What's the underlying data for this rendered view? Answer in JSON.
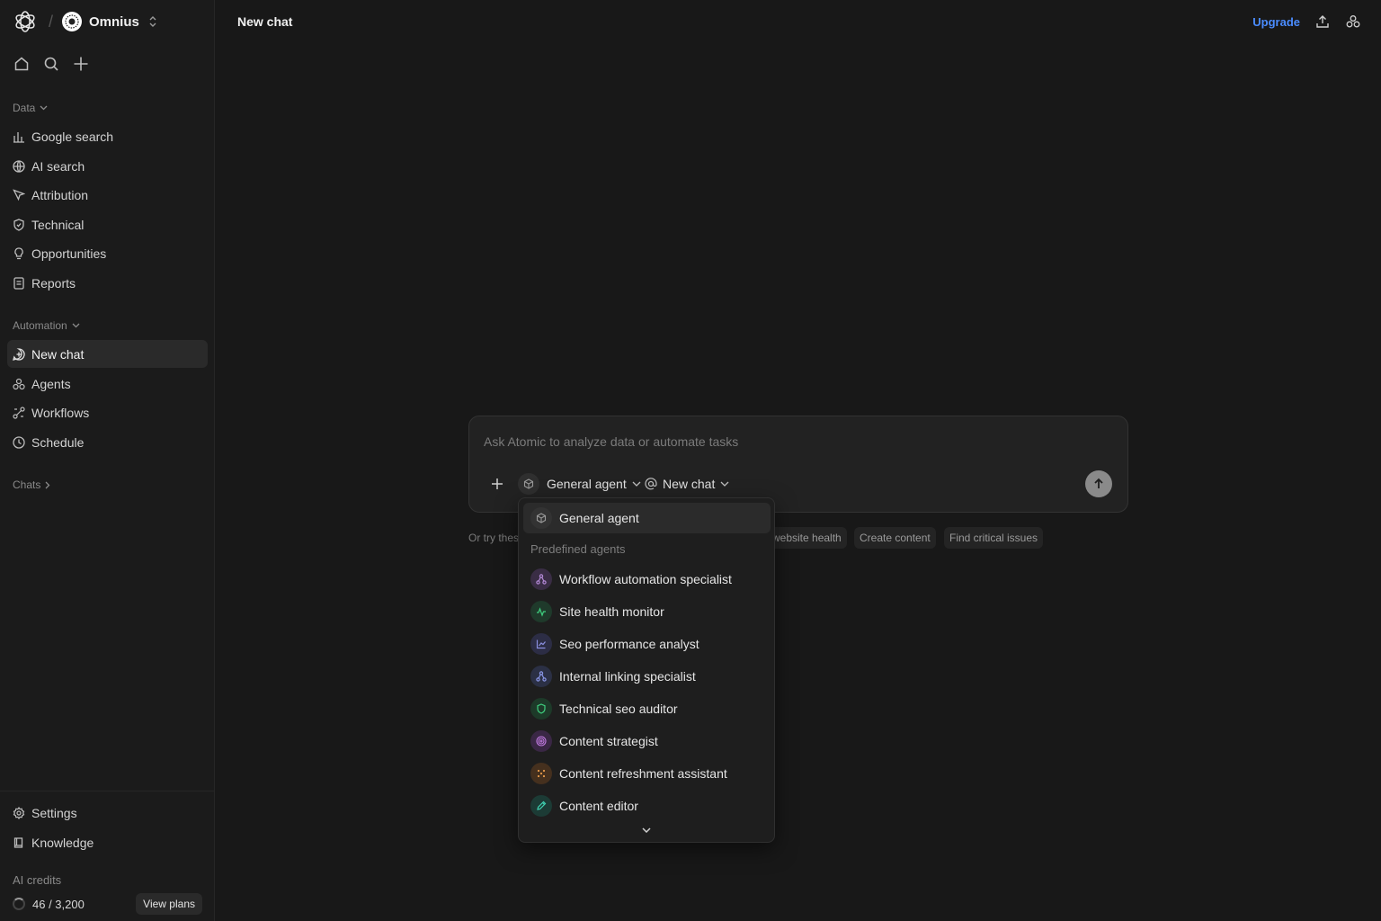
{
  "app": {
    "workspace_name": "Omnius"
  },
  "sidebar": {
    "data_section_label": "Data",
    "data_items": [
      {
        "label": "Google search",
        "icon": "bar-chart-icon"
      },
      {
        "label": "AI search",
        "icon": "globe-icon"
      },
      {
        "label": "Attribution",
        "icon": "cursor-icon"
      },
      {
        "label": "Technical",
        "icon": "shield-icon"
      },
      {
        "label": "Opportunities",
        "icon": "lightbulb-icon"
      },
      {
        "label": "Reports",
        "icon": "report-icon"
      }
    ],
    "automation_section_label": "Automation",
    "automation_items": [
      {
        "label": "New chat",
        "icon": "chat-plus-icon",
        "active": true
      },
      {
        "label": "Agents",
        "icon": "agents-icon"
      },
      {
        "label": "Workflows",
        "icon": "workflow-icon"
      },
      {
        "label": "Schedule",
        "icon": "clock-icon"
      }
    ],
    "chats_section_label": "Chats",
    "bottom_items": [
      {
        "label": "Settings",
        "icon": "gear-icon"
      },
      {
        "label": "Knowledge",
        "icon": "book-icon"
      }
    ],
    "credits_label": "AI credits",
    "credits_value": "46 / 3,200",
    "credits_used": 46,
    "credits_total": 3200,
    "view_plans_label": "View plans"
  },
  "header": {
    "title": "New chat",
    "upgrade_label": "Upgrade"
  },
  "composer": {
    "placeholder": "Ask Atomic to analyze data or automate tasks",
    "agent_label": "General agent",
    "chat_label": "New chat"
  },
  "suggestions": {
    "prefix": "Or try thes",
    "chips": [
      "website health",
      "Create content",
      "Find critical issues"
    ]
  },
  "agent_dropdown": {
    "selected": "General agent",
    "group_label": "Predefined agents",
    "agents": [
      {
        "label": "Workflow automation specialist",
        "icon": "workflow-icon",
        "color": "#b58ad8",
        "bg": "#3a2d45"
      },
      {
        "label": "Site health monitor",
        "icon": "pulse-icon",
        "color": "#3fcf7f",
        "bg": "#1f3a2b"
      },
      {
        "label": "Seo performance analyst",
        "icon": "line-chart-icon",
        "color": "#8a8fe0",
        "bg": "#2c2d45"
      },
      {
        "label": "Internal linking specialist",
        "icon": "network-icon",
        "color": "#8a97e8",
        "bg": "#2b3045"
      },
      {
        "label": "Technical seo auditor",
        "icon": "shield-icon",
        "color": "#3fcf7f",
        "bg": "#1d3a29"
      },
      {
        "label": "Content strategist",
        "icon": "target-icon",
        "color": "#c07ae0",
        "bg": "#3a2745"
      },
      {
        "label": "Content refreshment assistant",
        "icon": "sparkle-icon",
        "color": "#e89a4a",
        "bg": "#45301e"
      },
      {
        "label": "Content editor",
        "icon": "pencil-icon",
        "color": "#3fd0b0",
        "bg": "#1c3b35"
      }
    ]
  }
}
